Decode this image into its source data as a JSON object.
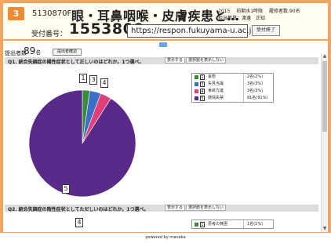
{
  "header": {
    "course_number": "3",
    "course_code": "5130870F",
    "title": "眼・耳鼻咽喉・皮膚疾患と…",
    "year_term": "2015",
    "period": "前期水1時限",
    "enrolled_label": "履修者数:90名",
    "instructor": "担当教員：渡邊　正知",
    "reception_label": "受付番号：",
    "reception_number": "1553809",
    "url": "https://respon.fukuyama-u.ac.jp",
    "end_button": "受付終了"
  },
  "summary": {
    "count_label": "提出者数",
    "count_value": "89",
    "count_unit": "名",
    "confirm_button": "提出者確認"
  },
  "questions": [
    {
      "text": "Q1. 統合失調症の陽性症状として正しいのはどれか。1つ選べ。",
      "buttons": [
        "表示する",
        "選択肢を表示しない"
      ]
    },
    {
      "text": "Q2. 統合失調症の陰性症状としてただしいのはどれか。1つ選べ。",
      "buttons": [
        "表示する",
        "選択肢を表示しない"
      ]
    }
  ],
  "chart_data": [
    {
      "type": "pie",
      "categories": [
        "妄想",
        "失見当識",
        "食欲亢進",
        "感情失禁"
      ],
      "keys": [
        "1",
        "3",
        "4",
        "5"
      ],
      "values": [
        2,
        3,
        3,
        81
      ],
      "labels": [
        "2名(2%)",
        "3名(3%)",
        "3名(3%)",
        "81名(91%)"
      ],
      "colors": [
        "#3a8c3a",
        "#3a6fc8",
        "#e0407a",
        "#5a2a8a"
      ]
    }
  ],
  "q2_preview": {
    "callout": "4",
    "legend_key": "1",
    "legend_label": "思考の貧困",
    "legend_value": "1名(1%)",
    "legend_color": "#3a8c3a"
  },
  "footer": {
    "text": "powered by manaba"
  }
}
